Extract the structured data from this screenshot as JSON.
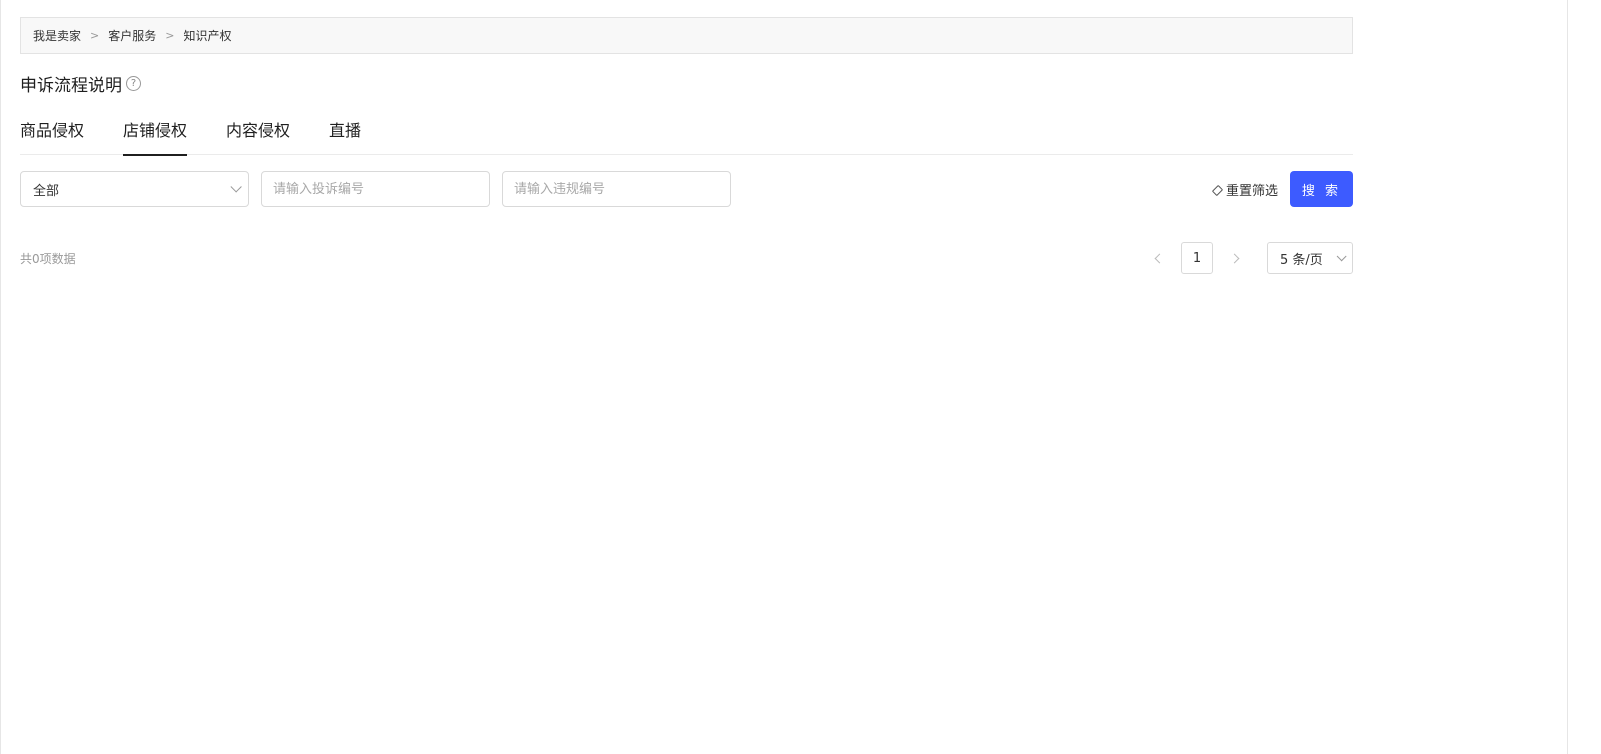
{
  "breadcrumb": {
    "items": [
      "我是卖家",
      "客户服务",
      "知识产权"
    ],
    "separator": ">"
  },
  "page": {
    "title": "申诉流程说明",
    "help_icon": "question-circle-icon"
  },
  "tabs": [
    {
      "label": "商品侵权",
      "active": false
    },
    {
      "label": "店铺侵权",
      "active": true
    },
    {
      "label": "内容侵权",
      "active": false
    },
    {
      "label": "直播",
      "active": false
    }
  ],
  "filters": {
    "status_select": {
      "value": "全部"
    },
    "complaint_id": {
      "placeholder": "请输入投诉编号"
    },
    "violation_id": {
      "placeholder": "请输入违规编号"
    },
    "reset_label": "重置筛选",
    "search_label": "搜 索"
  },
  "list": {
    "total_text": "共0项数据"
  },
  "pagination": {
    "current_page": "1",
    "page_size": "5 条/页"
  },
  "colors": {
    "primary": "#3d5bff",
    "border": "#d9d9d9",
    "muted_text": "#999999"
  }
}
